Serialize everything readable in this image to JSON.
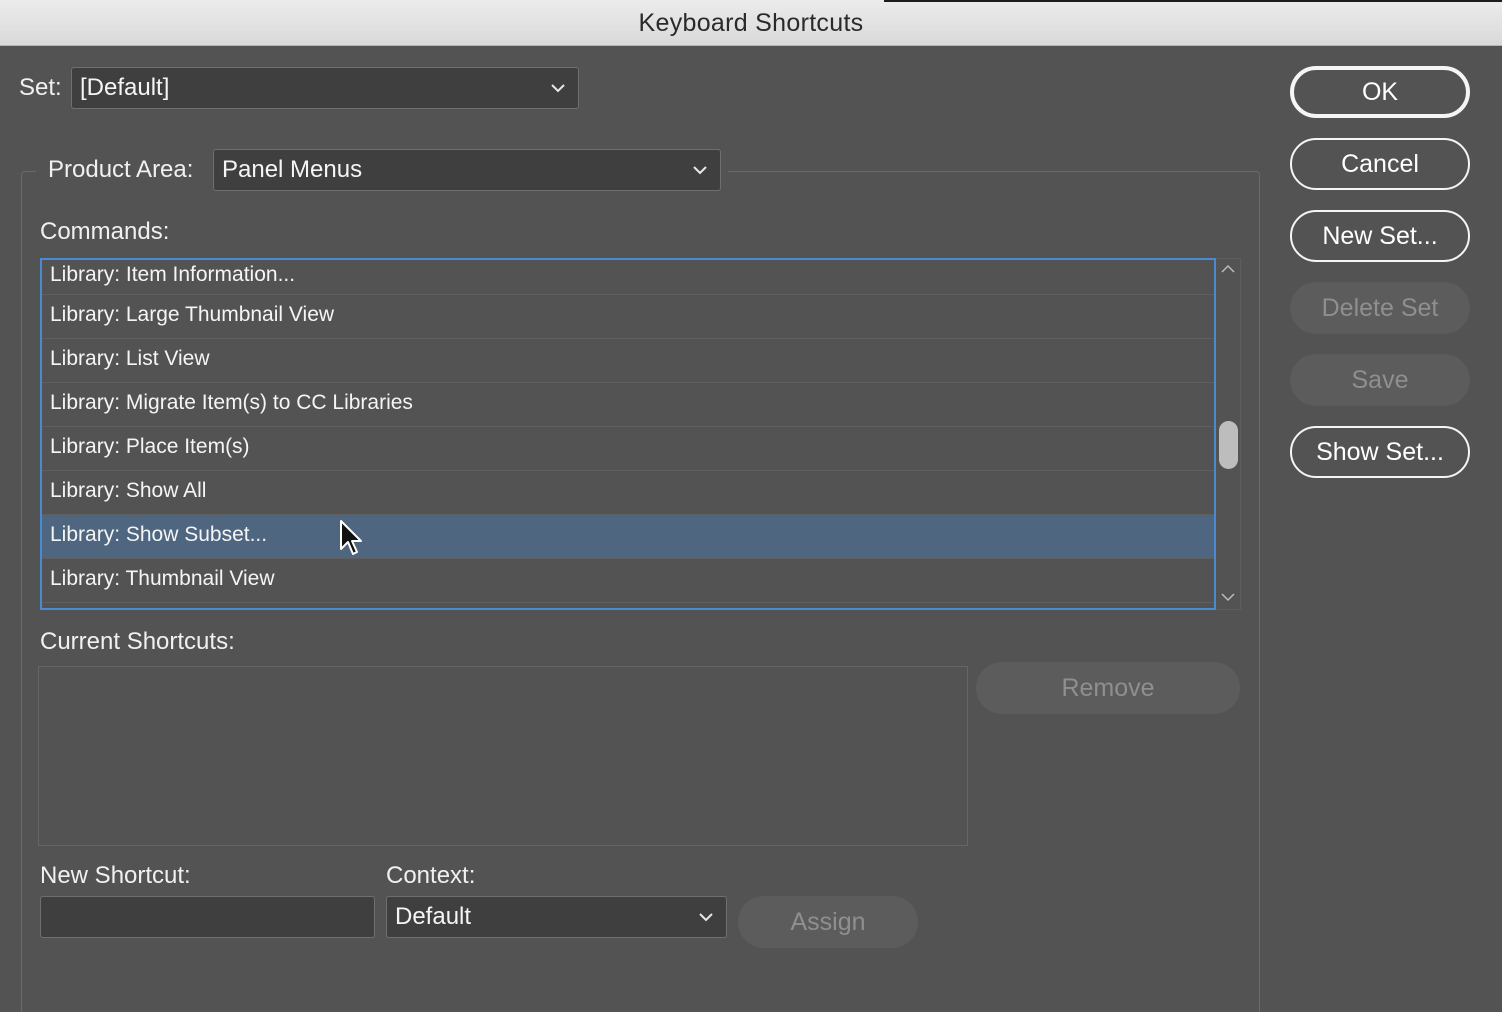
{
  "window": {
    "title": "Keyboard Shortcuts"
  },
  "set": {
    "label": "Set:",
    "value": "[Default]"
  },
  "product_area": {
    "label": "Product Area:",
    "value": "Panel Menus"
  },
  "commands": {
    "label": "Commands:",
    "items": [
      "Library: Item Information...",
      "Library: Large Thumbnail View",
      "Library: List View",
      "Library: Migrate Item(s) to CC Libraries",
      "Library: Place Item(s)",
      "Library: Show All",
      "Library: Show Subset...",
      "Library: Thumbnail View"
    ],
    "selected": "Library: Show Subset..."
  },
  "current_shortcuts": {
    "label": "Current Shortcuts:",
    "remove_label": "Remove"
  },
  "new_shortcut": {
    "label": "New Shortcut:",
    "value": ""
  },
  "context": {
    "label": "Context:",
    "value": "Default"
  },
  "assign_label": "Assign",
  "buttons": {
    "ok": "OK",
    "cancel": "Cancel",
    "new_set": "New Set...",
    "delete_set": "Delete Set",
    "save": "Save",
    "show_set": "Show Set..."
  },
  "colors": {
    "background": "#535353",
    "selection": "#4e6680",
    "focus_border": "#4a8ad0"
  }
}
